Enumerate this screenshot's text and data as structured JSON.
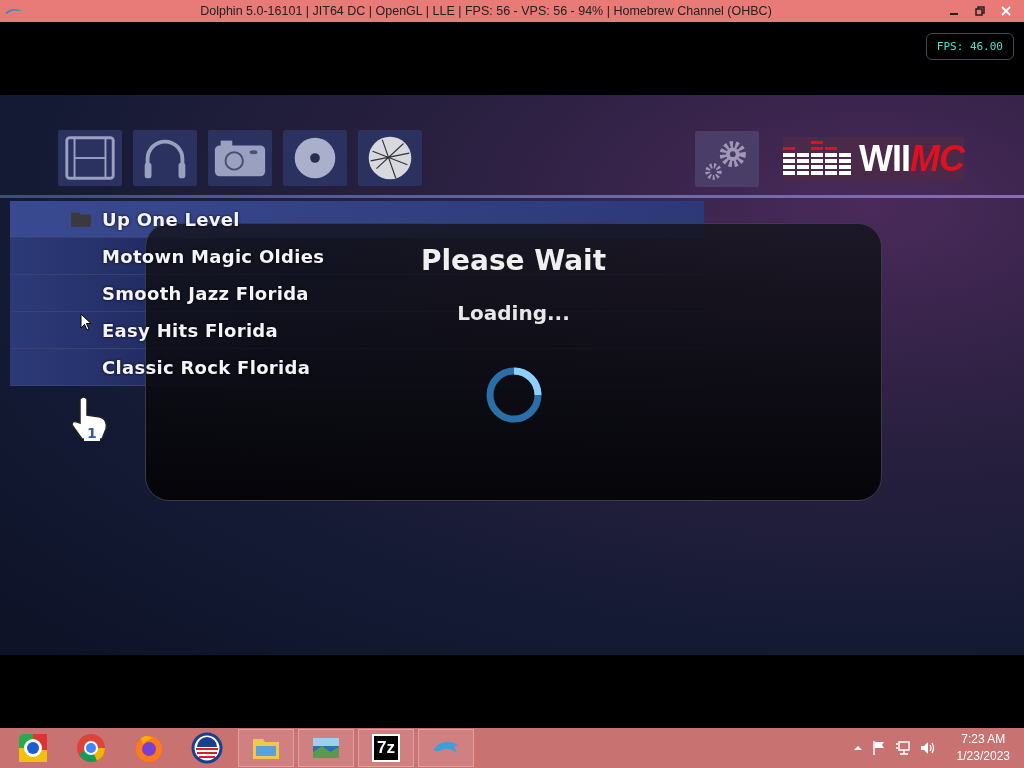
{
  "window": {
    "title": "Dolphin 5.0-16101 | JIT64 DC | OpenGL | LLE | FPS: 56 - VPS: 56 - 94% | Homebrew Channel (OHBC)"
  },
  "fps_overlay": "FPS: 46.00",
  "app": {
    "nav_icons": [
      {
        "kind": "film"
      },
      {
        "kind": "headphones"
      },
      {
        "kind": "camera"
      },
      {
        "kind": "disc"
      },
      {
        "kind": "globe"
      }
    ],
    "logo": {
      "text_main": "WII",
      "text_accent": "MC"
    },
    "list": [
      {
        "label": "Up One Level",
        "kind": "folder",
        "selected": true
      },
      {
        "label": "Motown Magic Oldies",
        "kind": "station",
        "selected": false
      },
      {
        "label": "Smooth Jazz Florida",
        "kind": "station",
        "selected": false
      },
      {
        "label": "Easy Hits Florida",
        "kind": "station",
        "selected": false
      },
      {
        "label": "Classic Rock Florida",
        "kind": "station",
        "selected": false
      }
    ],
    "pointer_badge": "1"
  },
  "dialog": {
    "title": "Please Wait",
    "message": "Loading..."
  },
  "taskbar": {
    "apps": [
      {
        "kind": "chrome-old",
        "open": false
      },
      {
        "kind": "chrome",
        "open": false
      },
      {
        "kind": "firefox",
        "open": false
      },
      {
        "kind": "stripes",
        "open": false
      },
      {
        "kind": "folder",
        "open": true
      },
      {
        "kind": "photo",
        "open": true
      },
      {
        "kind": "sevenzip",
        "open": true,
        "label": "7z"
      },
      {
        "kind": "dolphin",
        "open": true
      }
    ],
    "clock": {
      "time": "7:23 AM",
      "date": "1/23/2023"
    }
  }
}
